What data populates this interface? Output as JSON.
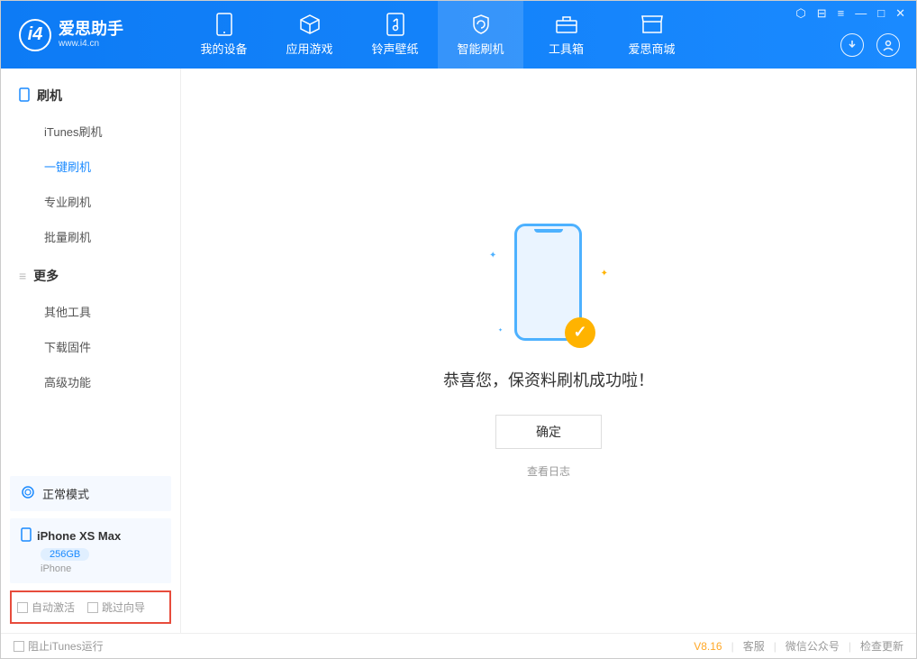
{
  "app": {
    "title": "爱思助手",
    "subtitle": "www.i4.cn"
  },
  "nav": {
    "tabs": [
      {
        "label": "我的设备"
      },
      {
        "label": "应用游戏"
      },
      {
        "label": "铃声壁纸"
      },
      {
        "label": "智能刷机"
      },
      {
        "label": "工具箱"
      },
      {
        "label": "爱思商城"
      }
    ]
  },
  "sidebar": {
    "section1": {
      "title": "刷机",
      "items": [
        "iTunes刷机",
        "一键刷机",
        "专业刷机",
        "批量刷机"
      ]
    },
    "section2": {
      "title": "更多",
      "items": [
        "其他工具",
        "下载固件",
        "高级功能"
      ]
    },
    "status": {
      "label": "正常模式"
    },
    "device": {
      "name": "iPhone XS Max",
      "storage": "256GB",
      "type": "iPhone"
    },
    "checks": {
      "auto_activate": "自动激活",
      "skip_guide": "跳过向导"
    }
  },
  "main": {
    "message": "恭喜您，保资料刷机成功啦！",
    "ok": "确定",
    "view_log": "查看日志"
  },
  "footer": {
    "block_itunes": "阻止iTunes运行",
    "version": "V8.16",
    "links": [
      "客服",
      "微信公众号",
      "检查更新"
    ]
  }
}
